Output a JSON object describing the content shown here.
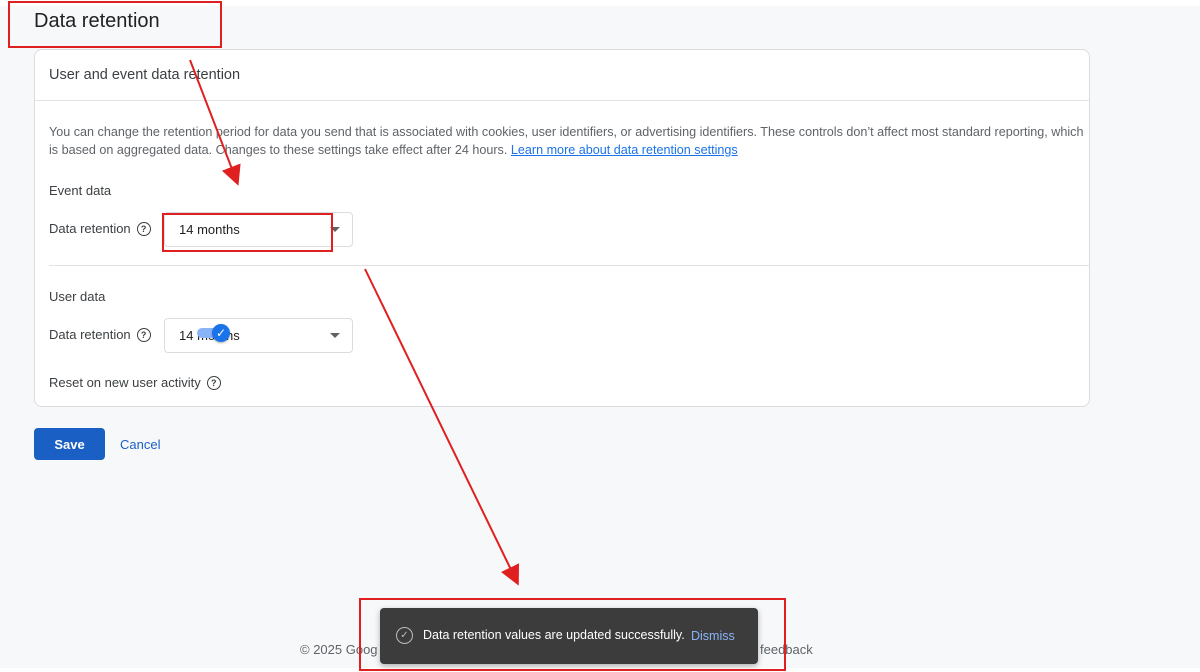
{
  "page": {
    "title": "Data retention"
  },
  "card": {
    "header": "User and event data retention",
    "description": "You can change the retention period for data you send that is associated with cookies, user identifiers, or advertising identifiers. These controls don’t affect most standard reporting, which is based on aggregated data. Changes to these settings take effect after 24 hours.",
    "learn_more_link": "Learn more about data retention settings"
  },
  "event_data": {
    "section_title": "Event data",
    "retention_label": "Data retention",
    "retention_value": "14 months"
  },
  "user_data": {
    "section_title": "User data",
    "retention_label": "Data retention",
    "retention_value": "14 months",
    "reset_label": "Reset on new user activity",
    "reset_enabled": true
  },
  "actions": {
    "save_label": "Save",
    "cancel_label": "Cancel"
  },
  "footer": {
    "left_text": "© 2025 Goog",
    "right_text": "feedback"
  },
  "snackbar": {
    "message": "Data retention values are updated successfully.",
    "dismiss_label": "Dismiss"
  },
  "icons": {
    "help": "help-circle-icon",
    "check": "check-icon",
    "dropdown": "caret-down-icon",
    "success": "check-circle-icon"
  },
  "colors": {
    "accent": "#1a73e8",
    "primary_button": "#1a5fc4",
    "annotation": "#e02020",
    "snackbar_bg": "#3c3c3c"
  }
}
